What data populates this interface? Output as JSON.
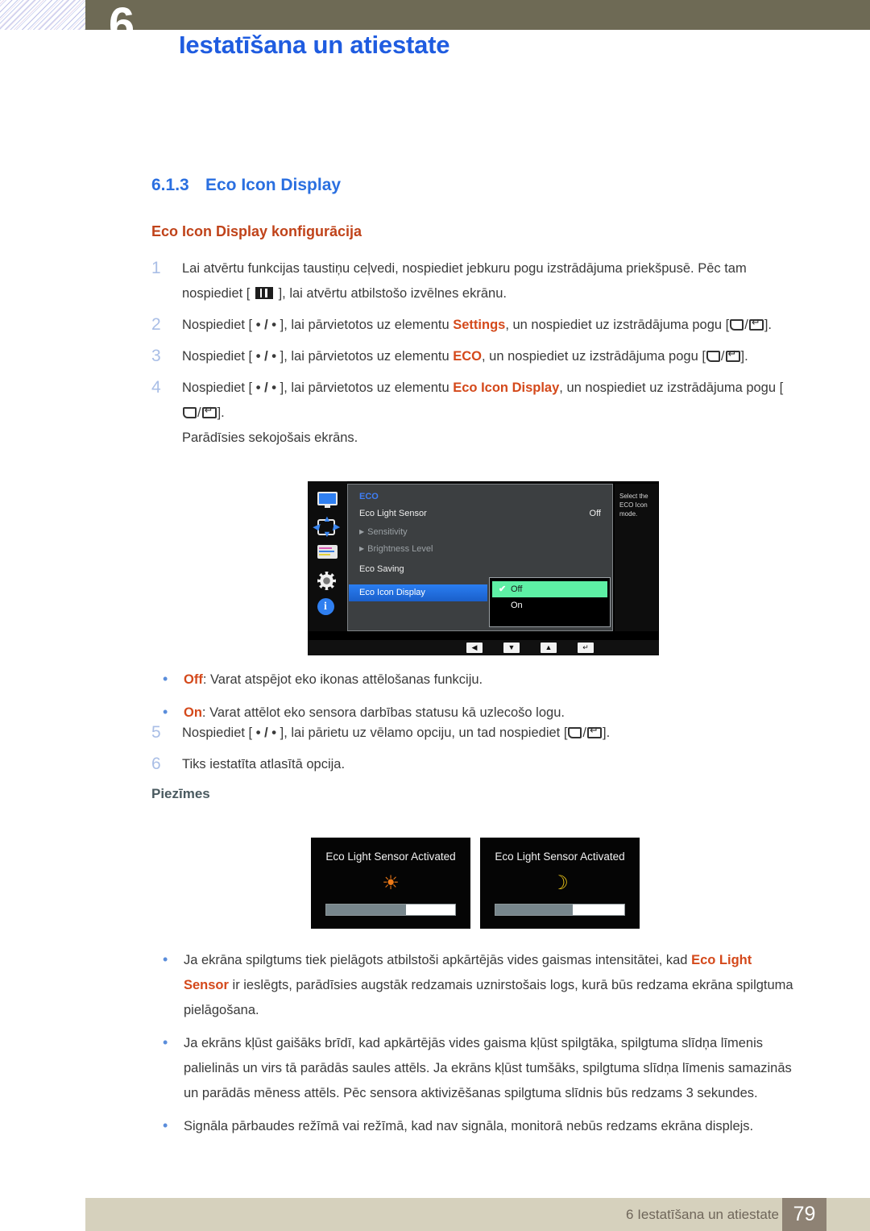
{
  "header": {
    "chapter_number": "6",
    "title": "Iestatīšana un atiestate"
  },
  "section": {
    "number": "6.1.3",
    "title": "Eco Icon Display",
    "subtitle": "Eco Icon Display konfigurācija"
  },
  "steps": [
    {
      "num": "1",
      "parts": [
        {
          "t": "text",
          "v": "Lai atvērtu funkcijas taustiņu ceļvedi, nospiediet jebkuru pogu izstrādājuma priekšpusē. Pēc tam nospiediet [ "
        },
        {
          "t": "icon",
          "v": "menu-key-icon"
        },
        {
          "t": "text",
          "v": " ], lai atvērtu atbilstošo izvēlnes ekrānu."
        }
      ]
    },
    {
      "num": "2",
      "parts": [
        {
          "t": "text",
          "v": "Nospiediet [ "
        },
        {
          "t": "icon",
          "v": "dot-slash-dot-key-icon"
        },
        {
          "t": "text",
          "v": " ], lai pārvietotos uz elementu "
        },
        {
          "t": "hl",
          "v": "Settings"
        },
        {
          "t": "text",
          "v": ", un nospiediet uz izstrādājuma pogu ["
        },
        {
          "t": "icon",
          "v": "back-enter-key-icon"
        },
        {
          "t": "text",
          "v": "]."
        }
      ]
    },
    {
      "num": "3",
      "parts": [
        {
          "t": "text",
          "v": "Nospiediet [ "
        },
        {
          "t": "icon",
          "v": "dot-slash-dot-key-icon"
        },
        {
          "t": "text",
          "v": " ], lai pārvietotos uz elementu "
        },
        {
          "t": "hl",
          "v": "ECO"
        },
        {
          "t": "text",
          "v": ", un nospiediet uz izstrādājuma pogu ["
        },
        {
          "t": "icon",
          "v": "back-enter-key-icon"
        },
        {
          "t": "text",
          "v": "]."
        }
      ]
    },
    {
      "num": "4",
      "parts": [
        {
          "t": "text",
          "v": "Nospiediet [ "
        },
        {
          "t": "icon",
          "v": "dot-slash-dot-key-icon"
        },
        {
          "t": "text",
          "v": " ], lai pārvietotos uz elementu "
        },
        {
          "t": "hl",
          "v": "Eco Icon Display"
        },
        {
          "t": "text",
          "v": ", un nospiediet uz izstrādājuma pogu ["
        },
        {
          "t": "icon",
          "v": "back-enter-key-icon"
        },
        {
          "t": "text",
          "v": "]."
        },
        {
          "t": "break",
          "v": ""
        },
        {
          "t": "text",
          "v": "Parādīsies sekojošais ekrāns."
        }
      ]
    }
  ],
  "steps_after": [
    {
      "num": "5",
      "parts": [
        {
          "t": "text",
          "v": "Nospiediet [ "
        },
        {
          "t": "icon",
          "v": "dot-slash-dot-key-icon"
        },
        {
          "t": "text",
          "v": " ], lai pārietu uz vēlamo opciju, un tad nospiediet ["
        },
        {
          "t": "icon",
          "v": "back-enter-key-icon"
        },
        {
          "t": "text",
          "v": "]."
        }
      ]
    },
    {
      "num": "6",
      "parts": [
        {
          "t": "text",
          "v": "Tiks iestatīta atlasītā opcija."
        }
      ]
    }
  ],
  "option_bullets": [
    {
      "parts": [
        {
          "t": "hl",
          "v": "Off"
        },
        {
          "t": "text",
          "v": ": Varat atspējot eko ikonas attēlošanas funkciju."
        }
      ]
    },
    {
      "parts": [
        {
          "t": "hl",
          "v": "On"
        },
        {
          "t": "text",
          "v": ": Varat attēlot eko sensora darbības statusu kā uzlecošo logu."
        }
      ]
    }
  ],
  "notes": {
    "heading": "Piezīmes",
    "items": [
      {
        "parts": [
          {
            "t": "text",
            "v": "Ja ekrāna spilgtums tiek pielāgots atbilstoši apkārtējās vides gaismas intensitātei, kad "
          },
          {
            "t": "hl",
            "v": "Eco Light Sensor"
          },
          {
            "t": "text",
            "v": " ir ieslēgts, parādīsies augstāk redzamais uznirstošais logs, kurā būs redzama ekrāna spilgtuma pielāgošana."
          }
        ]
      },
      {
        "parts": [
          {
            "t": "text",
            "v": "Ja ekrāns kļūst gaišāks brīdī, kad apkārtējās vides gaisma kļūst spilgtāka, spilgtuma slīdņa līmenis palielinās un virs tā parādās saules attēls. Ja ekrāns kļūst tumšāks, spilgtuma slīdņa līmenis samazinās un parādās mēness attēls. Pēc sensora aktivizēšanas spilgtuma slīdnis būs redzams 3 sekundes."
          }
        ]
      },
      {
        "parts": [
          {
            "t": "text",
            "v": "Signāla pārbaudes režīmā vai režīmā, kad nav signāla, monitorā nebūs redzams ekrāna displejs."
          }
        ]
      }
    ]
  },
  "osd": {
    "menu_title": "ECO",
    "rows": [
      {
        "label": "Eco Light Sensor",
        "value": "Off",
        "dim": false,
        "arrow": false
      },
      {
        "label": "Sensitivity",
        "value": "",
        "dim": true,
        "arrow": true
      },
      {
        "label": "Brightness Level",
        "value": "",
        "dim": true,
        "arrow": true
      },
      {
        "label": "Eco Saving",
        "value": "",
        "dim": false,
        "arrow": false
      }
    ],
    "selected_row": "Eco Icon Display",
    "dropdown": {
      "options": [
        {
          "label": "Off",
          "selected": true
        },
        {
          "label": "On",
          "selected": false
        }
      ],
      "check_glyph": "✔"
    },
    "help_text": "Select the ECO Icon mode.",
    "nav_buttons": [
      {
        "name": "left-arrow-button",
        "glyph": "◀"
      },
      {
        "name": "down-arrow-button",
        "glyph": "▼"
      },
      {
        "name": "up-arrow-button",
        "glyph": "▲"
      },
      {
        "name": "enter-button",
        "glyph": "↵"
      }
    ],
    "sidebar_icons": [
      "monitor-icon",
      "move-arrows-icon",
      "color-bars-icon",
      "gear-icon",
      "info-icon"
    ]
  },
  "sensor_popups": [
    {
      "label": "Eco Light Sensor Activated",
      "glyph": "☀",
      "glyph_name": "sun-icon",
      "fill_percent": 62
    },
    {
      "label": "Eco Light Sensor Activated",
      "glyph": "☽",
      "glyph_name": "moon-icon",
      "fill_percent": 60
    }
  ],
  "footer": {
    "text": "6 Iestatīšana un atiestate",
    "page": "79"
  },
  "colors": {
    "header_blue": "#1f5ce0",
    "heading_blue": "#2a6fe0",
    "accent_orange": "#c0431a",
    "inline_hl": "#d4491b",
    "olive": "#6e6a55",
    "footer_beige": "#d6d1bd",
    "footer_page_brown": "#8e8274",
    "osd_green": "#5df0a5",
    "osd_blue": "#2a7ef2"
  }
}
